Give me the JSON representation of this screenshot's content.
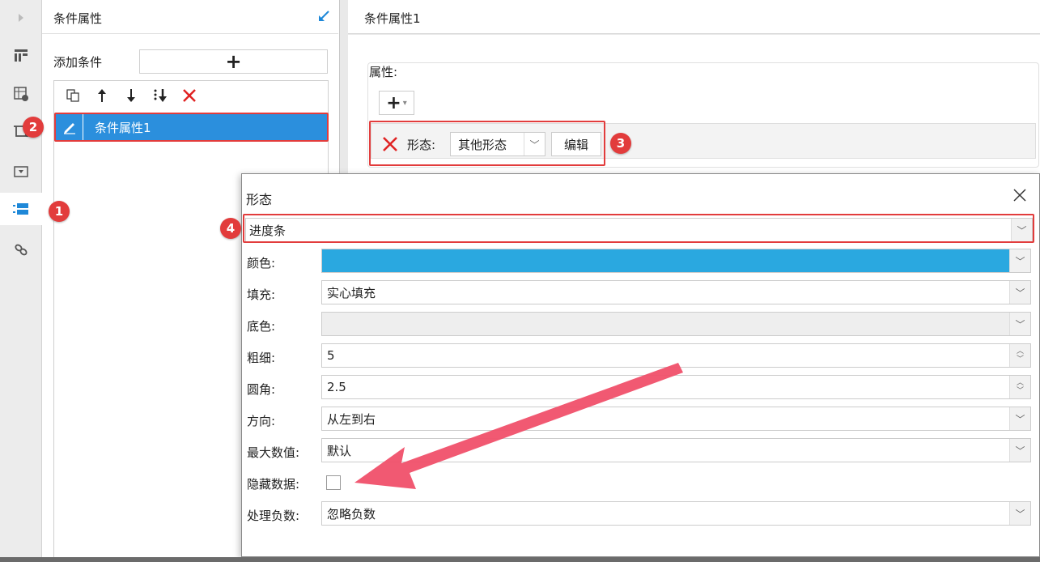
{
  "rail": {
    "icons": [
      "expand-arrow-icon",
      "layout-icon",
      "table-settings-icon",
      "crop-icon",
      "dropdown-icon",
      "conditional-format-icon",
      "link-icon"
    ]
  },
  "condition_panel": {
    "title": "条件属性",
    "add_label": "添加条件",
    "add_button": "+",
    "items": [
      {
        "label": "条件属性1"
      }
    ]
  },
  "properties": {
    "title": "条件属性1",
    "attr_label": "属性:",
    "add_button": "+",
    "form_label": "形态:",
    "form_value": "其他形态",
    "edit_button": "编辑"
  },
  "dialog": {
    "title": "形态",
    "type_value": "进度条",
    "fields": {
      "color": {
        "label": "颜色:",
        "value": "#2aa8e0"
      },
      "fill": {
        "label": "填充:",
        "value": "实心填充"
      },
      "bg_color": {
        "label": "底色:",
        "value": ""
      },
      "thickness": {
        "label": "粗细:",
        "value": "5"
      },
      "radius": {
        "label": "圆角:",
        "value": "2.5"
      },
      "direction": {
        "label": "方向:",
        "value": "从左到右"
      },
      "max_value": {
        "label": "最大数值:",
        "value": "默认"
      },
      "hide_data": {
        "label": "隐藏数据:",
        "checked": false
      },
      "negative": {
        "label": "处理负数:",
        "value": "忽略负数"
      }
    }
  },
  "annotations": [
    "1",
    "2",
    "3",
    "4"
  ],
  "colors": {
    "accent": "#2b8fdd",
    "annotation": "#e23c3c",
    "arrow": "#f0506a"
  }
}
